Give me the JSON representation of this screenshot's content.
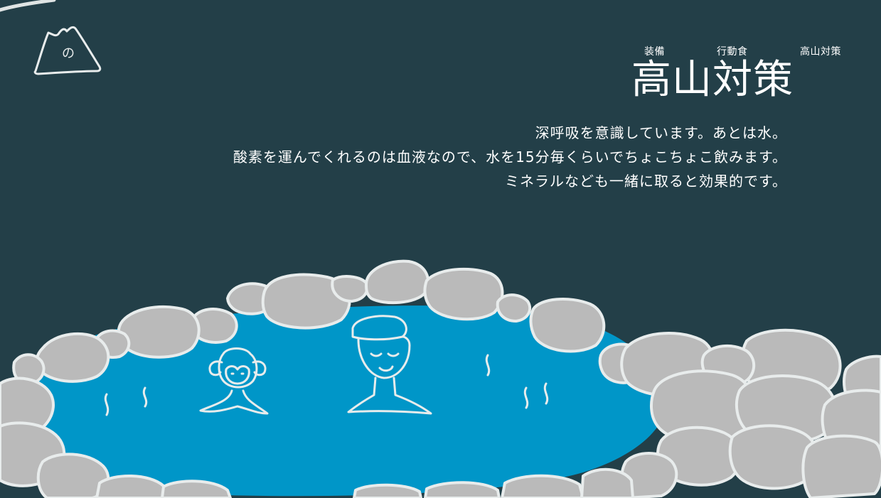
{
  "logo": {
    "glyph": "の",
    "icon": "mountain-logo-icon"
  },
  "nav": {
    "items": [
      {
        "label": "装備"
      },
      {
        "label": "行動食"
      },
      {
        "label": "高山対策"
      }
    ]
  },
  "page": {
    "title": "高山対策",
    "paragraphs": [
      "深呼吸を意識しています。あとは水。",
      "酸素を運んでくれるのは血液なので、水を15分毎くらいでちょこちょこ飲みます。",
      "ミネラルなども一緒に取ると効果的です。"
    ]
  },
  "colors": {
    "background": "#233f48",
    "water": "#0096c8",
    "rock": "#bababa",
    "chalk": "#e8ecec"
  }
}
